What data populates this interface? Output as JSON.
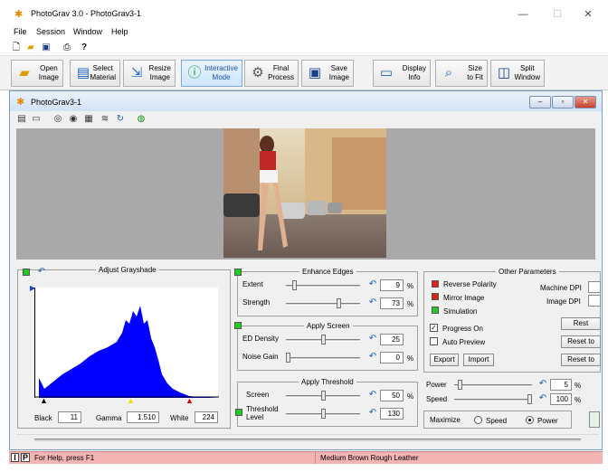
{
  "window": {
    "title": "PhotoGrav 3.0 - PhotoGrav3-1",
    "minimize": "—",
    "maximize": "☐",
    "close": "✕"
  },
  "menu": [
    "File",
    "Session",
    "Window",
    "Help"
  ],
  "toolbar": [
    {
      "label": "Open\nImage",
      "icon": "folder-icon"
    },
    {
      "label": "Select\nMaterial",
      "icon": "material-icon"
    },
    {
      "label": "Resize\nImage",
      "icon": "resize-icon"
    },
    {
      "label": "Interactive\nMode",
      "icon": "info-icon"
    },
    {
      "label": "Final\nProcess",
      "icon": "gear-icon"
    },
    {
      "label": "Save\nImage",
      "icon": "floppy-icon"
    },
    {
      "label": "Display\nInfo",
      "icon": "monitor-icon"
    },
    {
      "label": "Size\nto Fit",
      "icon": "magnifier-icon"
    },
    {
      "label": "Split\nWindow",
      "icon": "split-icon"
    }
  ],
  "child": {
    "title": "PhotoGrav3-1",
    "min": "‒",
    "max": "▫",
    "close": "✕"
  },
  "grayshade": {
    "title": "Adjust Grayshade",
    "black_label": "Black",
    "black": "11",
    "gamma_label": "Gamma",
    "gamma": "1.510",
    "white_label": "White",
    "white": "224"
  },
  "enhance": {
    "title": "Enhance Edges",
    "extent_label": "Extent",
    "extent": "9",
    "extent_unit": "%",
    "extent_level": 0.09,
    "strength_label": "Strength",
    "strength": "73",
    "strength_unit": "%",
    "strength_level": 0.73
  },
  "screen": {
    "title": "Apply Screen",
    "density_label": "ED Density",
    "density": "25",
    "density_level": 0.5,
    "noise_label": "Noise Gain",
    "noise": "0",
    "noise_unit": "%",
    "noise_level": 0.0
  },
  "threshold": {
    "title": "Apply Threshold",
    "screen_label": "Screen",
    "screen": "50",
    "screen_unit": "%",
    "screen_level": 0.5,
    "level_label": "Threshold\nLevel",
    "level": "130",
    "level_level": 0.51
  },
  "other": {
    "title": "Other Parameters",
    "reverse": "Reverse Polarity",
    "mirror": "Mirror Image",
    "simulation": "Simulation",
    "machine_dpi": "Machine DPI",
    "image_dpi": "Image DPI",
    "progress": "Progress On",
    "auto_preview": "Auto Preview",
    "reset": "Rest",
    "reset_to1": "Reset to",
    "reset_to2": "Reset to",
    "export": "Export",
    "import": "Import"
  },
  "power": {
    "power_label": "Power",
    "power": "5",
    "power_unit": "%",
    "power_level": 0.05,
    "speed_label": "Speed",
    "speed": "100",
    "speed_unit": "%",
    "speed_level": 1.0,
    "maximize_label": "Maximize",
    "opt_speed": "Speed",
    "opt_power": "Power",
    "selected": "Power"
  },
  "status": {
    "help": "For Help, press F1",
    "material": "Medium Brown Rough Leather"
  },
  "colors": {
    "accent": "#1a4fa0",
    "histogram": "#0000ff",
    "status_bg": "#f4b4b4"
  }
}
